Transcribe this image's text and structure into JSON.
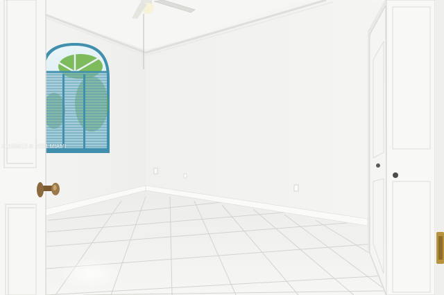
{
  "photo": {
    "subject": "empty room",
    "watermark": "A1180813 © 2024 MIAMI"
  },
  "colors": {
    "wall": "#f1f1ef",
    "ceiling": "#f7f7f5",
    "floor": "#efefec",
    "grout": "#cfcfca",
    "blinds": "#6aa8bd",
    "window_frame": "#3f8fad",
    "door": "#f7f7f7",
    "knob": "#8a6a3e"
  }
}
